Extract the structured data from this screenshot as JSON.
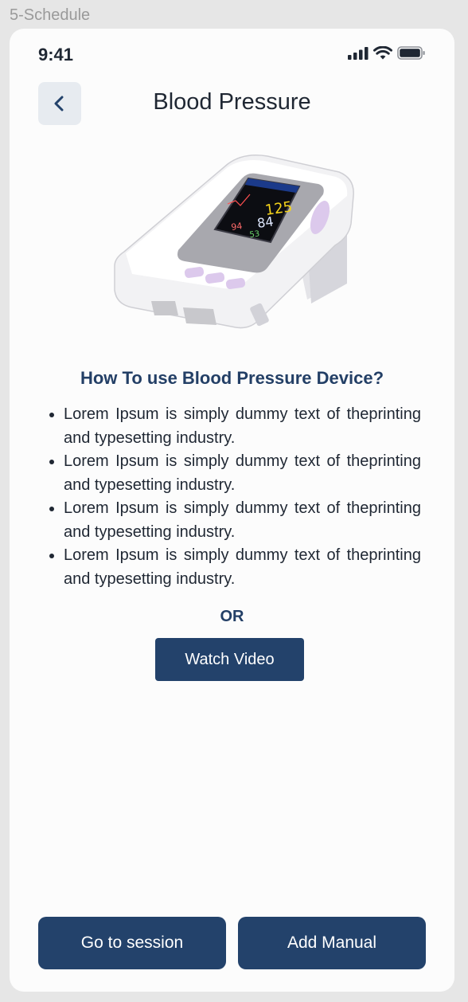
{
  "frame": {
    "label": "5-Schedule"
  },
  "status_bar": {
    "time": "9:41",
    "icons": [
      "signal-icon",
      "wifi-icon",
      "battery-icon"
    ]
  },
  "header": {
    "title": "Blood Pressure",
    "back_icon": "chevron-left-icon"
  },
  "device_image": {
    "screen_values": [
      "125",
      "84",
      "94",
      "53"
    ]
  },
  "content": {
    "heading": "How To use Blood Pressure Device?",
    "instructions": [
      "Lorem Ipsum is simply dummy text of theprinting and typesetting industry.",
      "Lorem Ipsum is simply dummy text of theprinting and typesetting industry.",
      "Lorem Ipsum is simply dummy text of theprinting and typesetting industry.",
      "Lorem Ipsum is simply dummy text of theprinting and typesetting industry."
    ],
    "separator": "OR",
    "watch_video_label": "Watch Video"
  },
  "footer": {
    "go_to_session_label": "Go to session",
    "add_manual_label": "Add Manual"
  },
  "colors": {
    "primary": "#23426b",
    "heading": "#233f66",
    "back_button_bg": "#e7ebf0",
    "background": "#fcfcfc"
  }
}
